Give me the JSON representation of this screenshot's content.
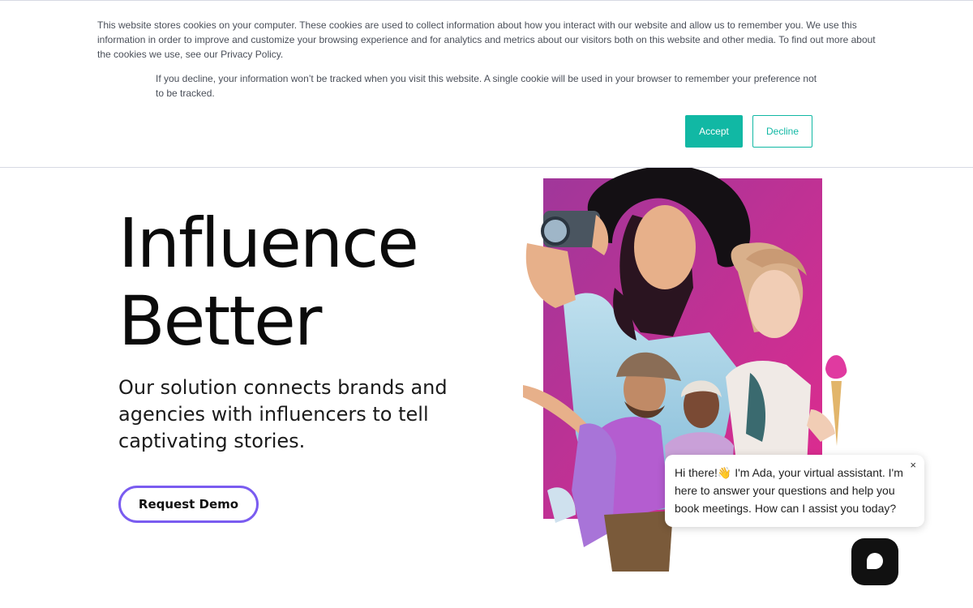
{
  "cookie_banner": {
    "main_text": "This website stores cookies on your computer. These cookies are used to collect information about how you interact with our website and allow us to remember you. We use this information in order to improve and customize your browsing experience and for analytics and metrics about our visitors both on this website and other media. To find out more about the cookies we use, see our Privacy Policy.",
    "decline_text": "If you decline, your information won’t be tracked when you visit this website. A single cookie will be used in your browser to remember your preference not to be tracked.",
    "accept_label": "Accept",
    "decline_label": "Decline",
    "accent_color": "#11b8a4"
  },
  "hero": {
    "title_line1": "Influence",
    "title_line2": "Better",
    "subtitle": "Our solution connects brands and agencies with influencers to tell captivating stories.",
    "cta_label": "Request Demo",
    "cta_border_color": "#7a5cf0",
    "image_backdrop_color": "#c0249a"
  },
  "chat": {
    "message": "Hi there!👋 I'm Ada, your virtual assistant. I'm here to answer your questions and help you book meetings. How can I assist you today?",
    "close_glyph": "×",
    "launcher_icon": "chat-bubble-icon"
  }
}
